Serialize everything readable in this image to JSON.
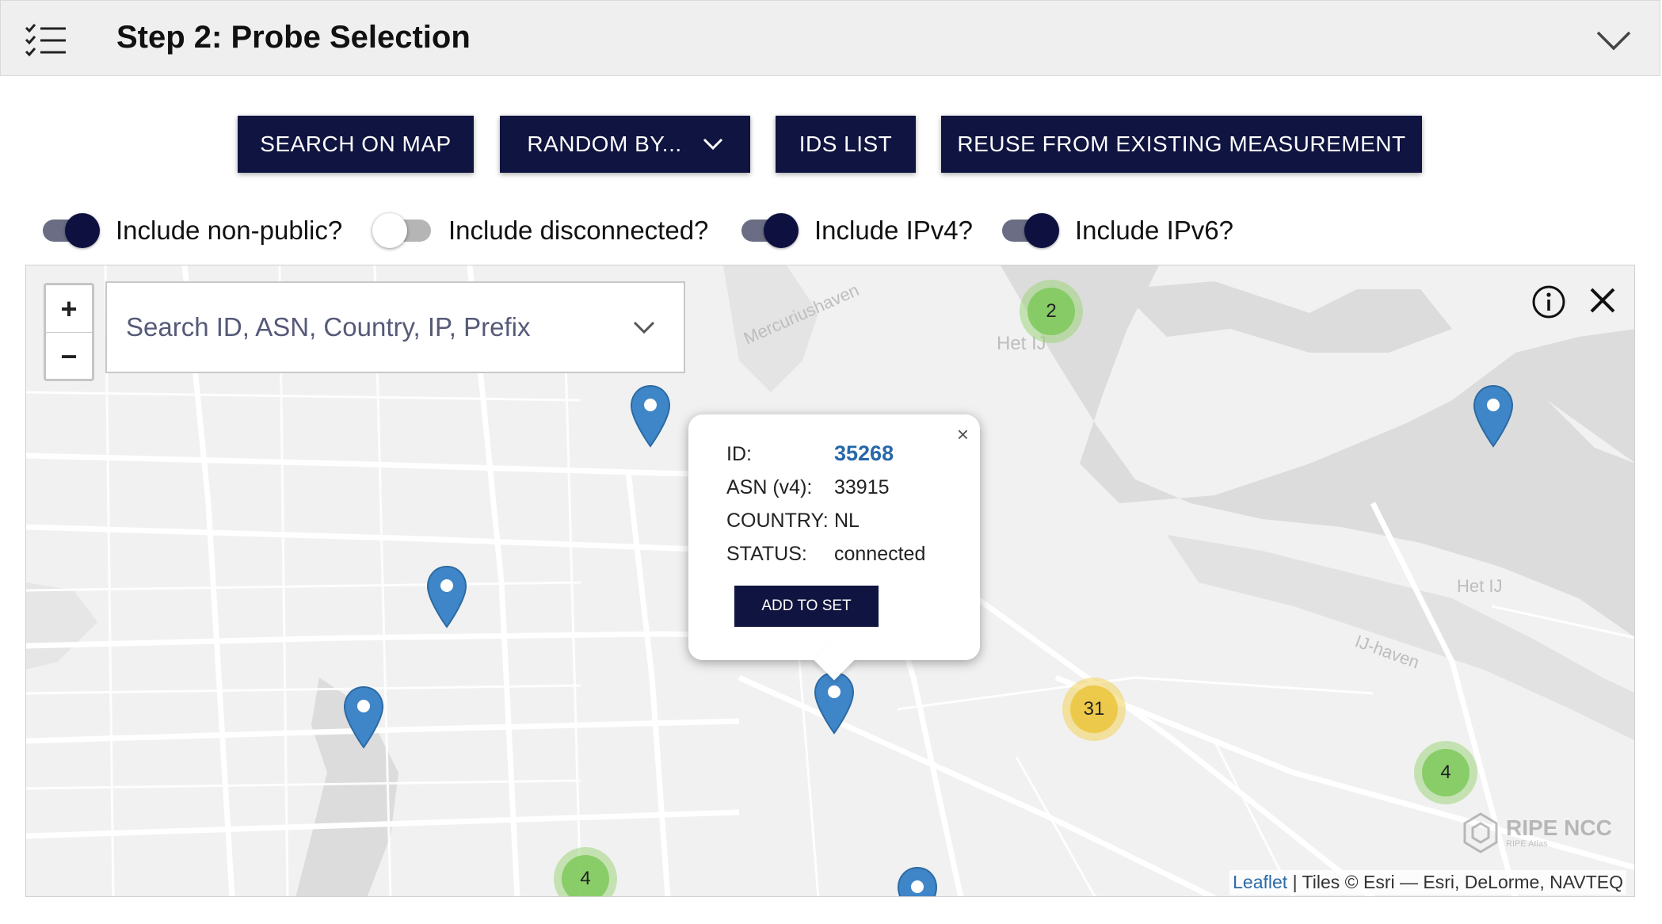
{
  "header": {
    "title": "Step 2: Probe Selection",
    "icon": "checklist-icon",
    "collapse_icon": "chevron-down-icon"
  },
  "buttons": {
    "search_on_map": "SEARCH ON MAP",
    "random_by": "RANDOM BY...",
    "ids_list": "IDS LIST",
    "reuse": "REUSE FROM EXISTING MEASUREMENT"
  },
  "toggles": [
    {
      "label": "Include non-public?",
      "on": true
    },
    {
      "label": "Include disconnected?",
      "on": false
    },
    {
      "label": "Include IPv4?",
      "on": true
    },
    {
      "label": "Include IPv6?",
      "on": true
    }
  ],
  "map": {
    "search_placeholder": "Search ID, ASN, Country, IP, Prefix",
    "zoom_in": "+",
    "zoom_out": "−",
    "street_labels": [
      "Mercuriushaven",
      "Het IJ",
      "Het IJ",
      "IJ-haven"
    ],
    "clusters": [
      {
        "count": "2",
        "color": "green"
      },
      {
        "count": "31",
        "color": "yellow"
      },
      {
        "count": "4",
        "color": "green"
      },
      {
        "count": "4",
        "color": "green"
      }
    ],
    "popup": {
      "id_label": "ID:",
      "id_value": "35268",
      "asn_label": "ASN (v4):",
      "asn_value": "33915",
      "country_label": "COUNTRY:",
      "country_value": "NL",
      "status_label": "STATUS:",
      "status_value": "connected",
      "add_button": "ADD TO SET",
      "close": "×"
    },
    "attribution": {
      "link": "Leaflet",
      "text": "| Tiles © Esri — Esri, DeLorme, NAVTEQ"
    },
    "watermark": {
      "title": "RIPE NCC",
      "subtitle": "RIPE Atlas"
    }
  },
  "colors": {
    "primary": "#101440",
    "pin": "#3f86c8",
    "link": "#2868a8",
    "header_bg": "#efefef"
  }
}
